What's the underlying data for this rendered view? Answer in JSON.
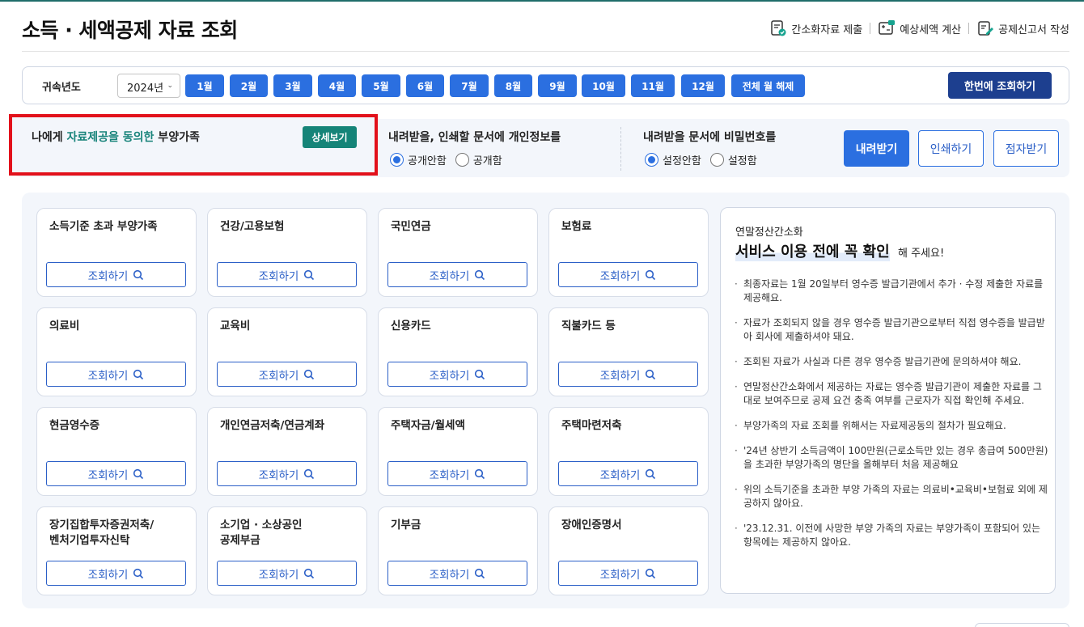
{
  "page_title": "소득 · 세액공제 자료 조회",
  "top_actions": [
    {
      "label": "간소화자료 제출",
      "icon": "document-submit-icon"
    },
    {
      "label": "예상세액 계산",
      "icon": "calculator-icon"
    },
    {
      "label": "공제신고서 작성",
      "icon": "edit-document-icon"
    }
  ],
  "filter": {
    "year_label": "귀속년도",
    "year_value": "2024년",
    "months": [
      "1월",
      "2월",
      "3월",
      "4월",
      "5월",
      "6월",
      "7월",
      "8월",
      "9월",
      "10월",
      "11월",
      "12월",
      "전체 월 해제"
    ],
    "bulk_button": "한번에 조회하기"
  },
  "consent": {
    "prefix": "나에게 ",
    "highlight": "자료제공을 동의한",
    "suffix": " 부양가족",
    "detail_button": "상세보기"
  },
  "options": {
    "privacy_title": "내려받을, 인쇄할 문서에 개인정보를",
    "privacy_opts": [
      "공개안함",
      "공개함"
    ],
    "privacy_selected": "공개안함",
    "password_title": "내려받을 문서에 비밀번호를",
    "password_opts": [
      "설정안함",
      "설정함"
    ],
    "password_selected": "설정안함",
    "download": "내려받기",
    "print": "인쇄하기",
    "braille": "점자받기"
  },
  "query_label": "조회하기",
  "categories": [
    "소득기준 초과 부양가족",
    "건강/고용보험",
    "국민연금",
    "보험료",
    "의료비",
    "교육비",
    "신용카드",
    "직불카드 등",
    "현금영수증",
    "개인연금저축/연금계좌",
    "주택자금/월세액",
    "주택마련저축",
    "장기집합투자증권저축/\n벤처기업투자신탁",
    "소기업 · 소상공인\n공제부금",
    "기부금",
    "장애인증명서"
  ],
  "notice": {
    "subtitle": "연말정산간소화",
    "headline": "서비스 이용 전에 꼭 확인",
    "headline_tail": "해 주세요!",
    "items": [
      "최종자료는 1월 20일부터 영수증 발급기관에서 추가 · 수정 제출한 자료를 제공해요.",
      "자료가 조회되지 않을 경우 영수증 발급기관으로부터 직접 영수증을 발급받아 회사에 제출하셔야 돼요.",
      "조회된 자료가 사실과 다른 경우 영수증 발급기관에 문의하셔야 해요.",
      "연말정산간소화에서 제공하는 자료는 영수증 발급기관이 제출한 자료를 그대로 보여주므로 공제 요건 충족 여부를 근로자가 직접 확인해 주세요.",
      "부양가족의 자료 조회를 위해서는 자료제공동의 절차가 필요해요.",
      "'24년 상반기 소득금액이 100만원(근로소득만 있는 경우 총급여 500만원)을 초과한 부양가족의 명단을 올해부터 처음 제공해요",
      "위의 소득기준을 초과한 부양 가족의 자료는 의료비•교육비•보험료 외에 제공하지 않아요.",
      "'23.12.31. 이전에 사망한 부양 가족의 자료는 부양가족이 포함되어 있는 항목에는 제공하지 않아요."
    ]
  },
  "colors": {
    "primary": "#2b6fe0",
    "teal": "#158478",
    "navy": "#1d3f8f",
    "highlight_border": "#e2111b"
  }
}
